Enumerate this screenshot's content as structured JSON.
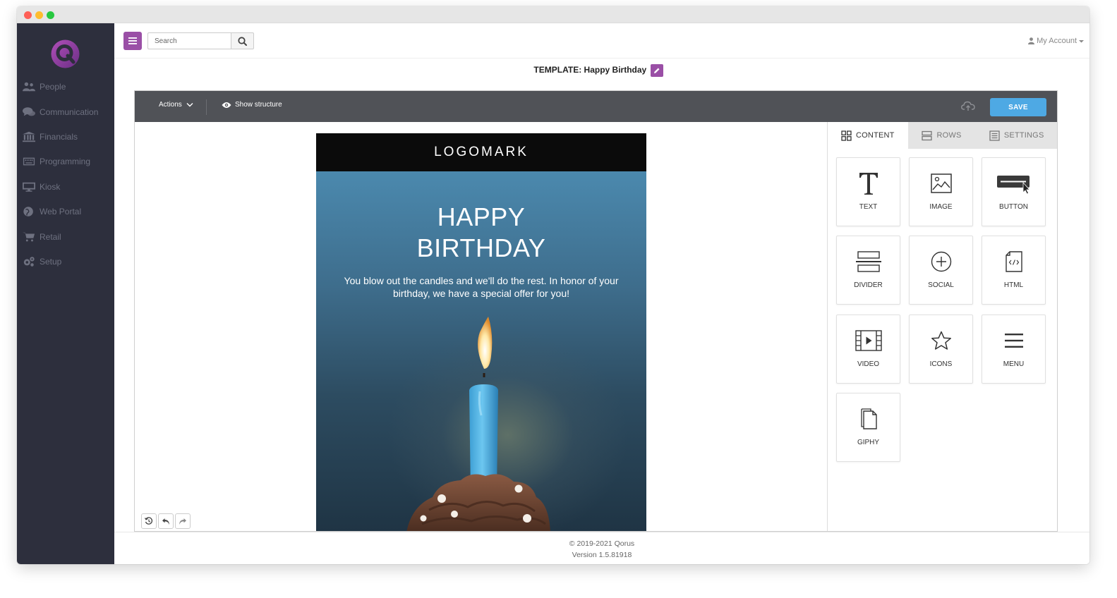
{
  "sidebar": {
    "items": [
      {
        "label": "People",
        "icon": "people-icon"
      },
      {
        "label": "Communication",
        "icon": "chat-icon"
      },
      {
        "label": "Financials",
        "icon": "bank-icon"
      },
      {
        "label": "Programming",
        "icon": "keyboard-icon"
      },
      {
        "label": "Kiosk",
        "icon": "monitor-icon"
      },
      {
        "label": "Web Portal",
        "icon": "globe-icon"
      },
      {
        "label": "Retail",
        "icon": "cart-icon"
      },
      {
        "label": "Setup",
        "icon": "gears-icon"
      }
    ]
  },
  "topbar": {
    "search_placeholder": "Search",
    "account_label": "My Account"
  },
  "template": {
    "title": "TEMPLATE: Happy Birthday"
  },
  "toolbar": {
    "actions_label": "Actions",
    "structure_label": "Show structure",
    "save_label": "SAVE"
  },
  "email": {
    "header": "LOGOMARK",
    "title_line1": "HAPPY",
    "title_line2": "BIRTHDAY",
    "text": "You blow out the candles and we'll do the rest. In honor of your birthday, we have a special offer for you!"
  },
  "panel": {
    "tabs": [
      {
        "label": "CONTENT",
        "active": true
      },
      {
        "label": "ROWS",
        "active": false
      },
      {
        "label": "SETTINGS",
        "active": false
      }
    ],
    "tiles": [
      {
        "label": "TEXT",
        "icon": "text-icon"
      },
      {
        "label": "IMAGE",
        "icon": "image-icon"
      },
      {
        "label": "BUTTON",
        "icon": "button-icon"
      },
      {
        "label": "DIVIDER",
        "icon": "divider-icon"
      },
      {
        "label": "SOCIAL",
        "icon": "plus-circle-icon"
      },
      {
        "label": "HTML",
        "icon": "html-file-icon"
      },
      {
        "label": "VIDEO",
        "icon": "video-icon"
      },
      {
        "label": "ICONS",
        "icon": "star-icon"
      },
      {
        "label": "MENU",
        "icon": "menu-icon"
      },
      {
        "label": "GIPHY",
        "icon": "giphy-file-icon"
      }
    ]
  },
  "footer": {
    "copyright": "© 2019-2021 Qorus",
    "version": "Version 1.5.81918"
  },
  "colors": {
    "brand_purple": "#9a4fa6",
    "sidebar_bg": "#2d2f3d",
    "toolbar_bg": "#505257",
    "save_blue": "#4ea9e4"
  }
}
